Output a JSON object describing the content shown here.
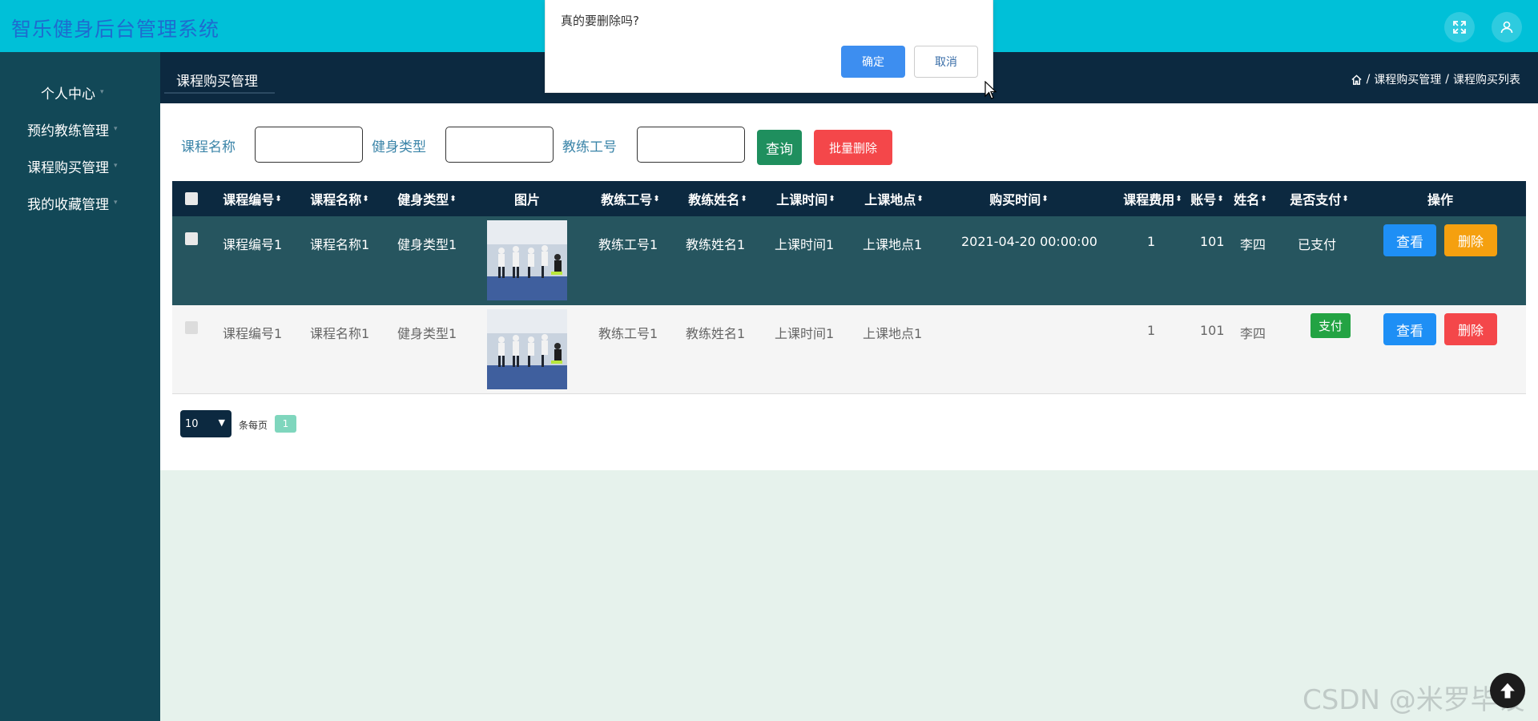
{
  "app": {
    "title": "智乐健身后台管理系统"
  },
  "header": {
    "icons": [
      "fullscreen-icon",
      "user-icon"
    ]
  },
  "sidebar": {
    "items": [
      {
        "label": "个人中心"
      },
      {
        "label": "预约教练管理"
      },
      {
        "label": "课程购买管理"
      },
      {
        "label": "我的收藏管理"
      }
    ]
  },
  "breadcrumb": {
    "tab": "课程购买管理",
    "path": [
      "课程购买管理",
      "课程购买列表"
    ],
    "separator": "/"
  },
  "search": {
    "fields": [
      {
        "label": "课程名称",
        "value": ""
      },
      {
        "label": "健身类型",
        "value": ""
      },
      {
        "label": "教练工号",
        "value": ""
      }
    ],
    "query_label": "查询",
    "batch_delete_label": "批量删除"
  },
  "table": {
    "headers": [
      "课程编号",
      "课程名称",
      "健身类型",
      "图片",
      "教练工号",
      "教练姓名",
      "上课时间",
      "上课地点",
      "购买时间",
      "课程费用",
      "账号",
      "姓名",
      "是否支付",
      "操作"
    ],
    "rows": [
      {
        "course_no": "课程编号1",
        "course_name": "课程名称1",
        "fitness_type": "健身类型1",
        "coach_no": "教练工号1",
        "coach_name": "教练姓名1",
        "class_time": "上课时间1",
        "class_place": "上课地点1",
        "purchase_time": "2021-04-20 00:00:00",
        "fee": "1",
        "account": "101",
        "name": "李四",
        "paid": "已支付"
      },
      {
        "course_no": "课程编号1",
        "course_name": "课程名称1",
        "fitness_type": "健身类型1",
        "coach_no": "教练工号1",
        "coach_name": "教练姓名1",
        "class_time": "上课时间1",
        "class_place": "上课地点1",
        "purchase_time": "",
        "fee": "1",
        "account": "101",
        "name": "李四",
        "pay_button": "支付"
      }
    ],
    "view_label": "查看",
    "delete_label": "删除",
    "colors": {
      "delete_row1": "#f5a00f",
      "delete_row2": "#f4474a"
    }
  },
  "pagination": {
    "page_size": "10",
    "per_page_label": "条每页",
    "current_page": "1"
  },
  "dialog": {
    "message": "真的要删除吗?",
    "ok_label": "确定",
    "cancel_label": "取消"
  },
  "watermark": "CSDN @米罗毕设"
}
